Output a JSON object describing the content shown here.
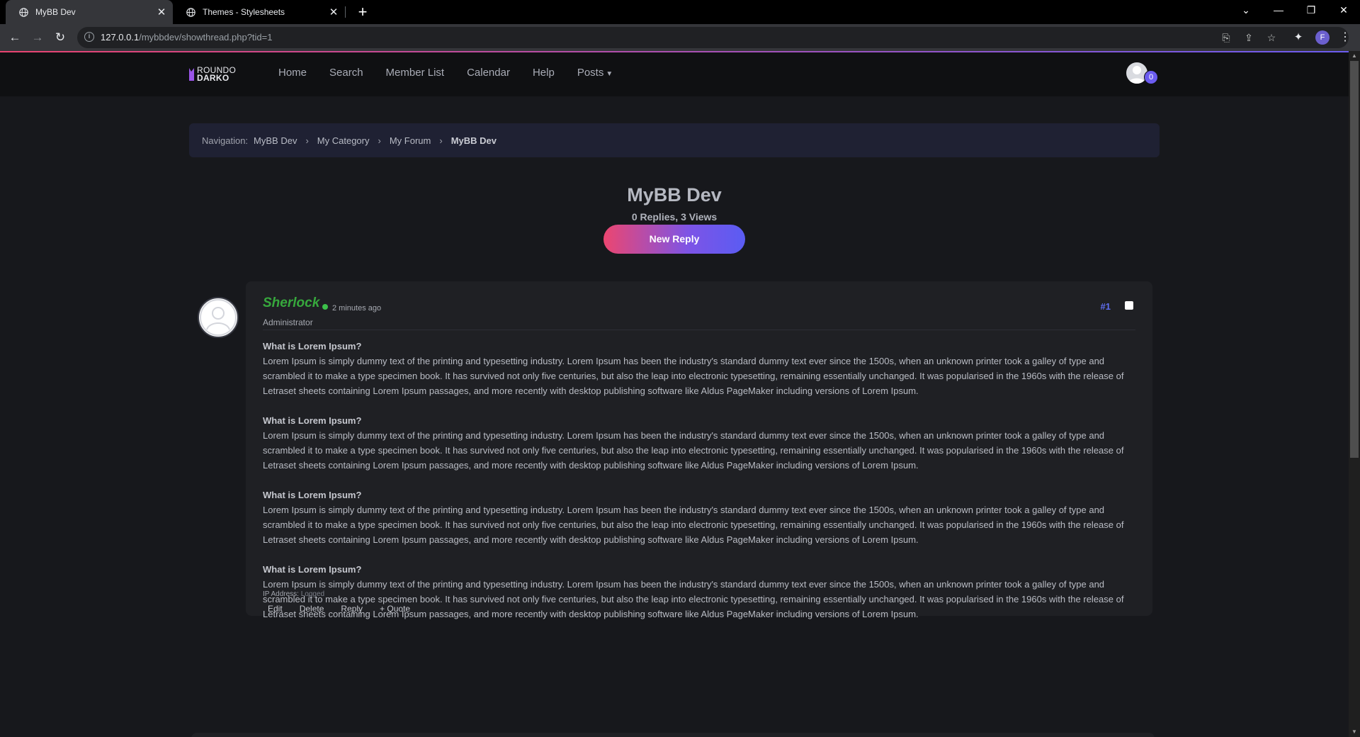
{
  "browser": {
    "tabs": [
      {
        "title": "MyBB Dev",
        "active": true
      },
      {
        "title": "Themes - Stylesheets",
        "active": false
      }
    ],
    "url_host": "127.0.0.1",
    "url_path": "/mybbdev/showthread.php?tid=1",
    "profile_initial": "F"
  },
  "site": {
    "logo_line1": "ROUNDO",
    "logo_line2": "DARKO",
    "nav": [
      "Home",
      "Search",
      "Member List",
      "Calendar",
      "Help",
      "Posts"
    ],
    "notification_count": "0",
    "accent_start": "#e9436f",
    "accent_end": "#6b5cf0"
  },
  "breadcrumb": {
    "label": "Navigation:",
    "items": [
      "MyBB Dev",
      "My Category",
      "My Forum"
    ],
    "current": "MyBB Dev"
  },
  "thread": {
    "title": "MyBB Dev",
    "stats": "0 Replies, 3 Views",
    "new_reply_label": "New Reply"
  },
  "post": {
    "author": "Sherlock",
    "date": "2 minutes ago",
    "role": "Administrator",
    "number": "#1",
    "paragraphs": [
      {
        "heading": "What is Lorem Ipsum?",
        "text": "Lorem Ipsum is simply dummy text of the printing and typesetting industry. Lorem Ipsum has been the industry's standard dummy text ever since the 1500s, when an unknown printer took a galley of type and scrambled it to make a type specimen book. It has survived not only five centuries, but also the leap into electronic typesetting, remaining essentially unchanged. It was popularised in the 1960s with the release of Letraset sheets containing Lorem Ipsum passages, and more recently with desktop publishing software like Aldus PageMaker including versions of Lorem Ipsum."
      },
      {
        "heading": "What is Lorem Ipsum?",
        "text": "Lorem Ipsum is simply dummy text of the printing and typesetting industry. Lorem Ipsum has been the industry's standard dummy text ever since the 1500s, when an unknown printer took a galley of type and scrambled it to make a type specimen book. It has survived not only five centuries, but also the leap into electronic typesetting, remaining essentially unchanged. It was popularised in the 1960s with the release of Letraset sheets containing Lorem Ipsum passages, and more recently with desktop publishing software like Aldus PageMaker including versions of Lorem Ipsum."
      },
      {
        "heading": "What is Lorem Ipsum?",
        "text": "Lorem Ipsum is simply dummy text of the printing and typesetting industry. Lorem Ipsum has been the industry's standard dummy text ever since the 1500s, when an unknown printer took a galley of type and scrambled it to make a type specimen book. It has survived not only five centuries, but also the leap into electronic typesetting, remaining essentially unchanged. It was popularised in the 1960s with the release of Letraset sheets containing Lorem Ipsum passages, and more recently with desktop publishing software like Aldus PageMaker including versions of Lorem Ipsum."
      },
      {
        "heading": "What is Lorem Ipsum?",
        "text": "Lorem Ipsum is simply dummy text of the printing and typesetting industry. Lorem Ipsum has been the industry's standard dummy text ever since the 1500s, when an unknown printer took a galley of type and scrambled it to make a type specimen book. It has survived not only five centuries, but also the leap into electronic typesetting, remaining essentially unchanged. It was popularised in the 1960s with the release of Letraset sheets containing Lorem Ipsum passages, and more recently with desktop publishing software like Aldus PageMaker including versions of Lorem Ipsum."
      }
    ],
    "ip_label": "IP Address:",
    "ip_value": "Logged",
    "actions": [
      "Edit",
      "Delete",
      "Reply",
      "+ Quote"
    ],
    "author_color": "#37a83d"
  }
}
